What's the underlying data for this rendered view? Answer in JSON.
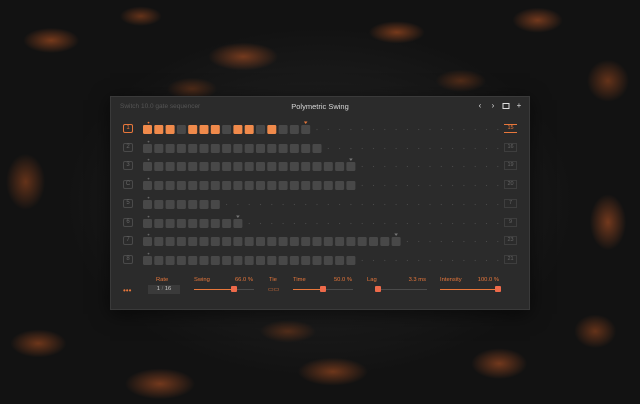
{
  "header": {
    "app_title": "Switch 10.0 gate sequencer",
    "preset_name": "Polymetric Swing"
  },
  "colors": {
    "accent": "#e8773b",
    "step_off": "#484848",
    "step_on": "#f08a4b",
    "panel": "#2b2b2b",
    "knob": "#ee6a4a"
  },
  "tracks": [
    {
      "label": "1",
      "length": "15",
      "steps": 15,
      "active_steps": [
        0,
        1,
        2,
        4,
        5,
        6,
        8,
        9,
        11
      ],
      "playhead": 14,
      "selected": true
    },
    {
      "label": "2",
      "length": "16",
      "steps": 16,
      "active_steps": [],
      "playhead": null,
      "selected": false
    },
    {
      "label": "3",
      "length": "19",
      "steps": 19,
      "active_steps": [],
      "playhead": 18,
      "selected": false
    },
    {
      "label": "C",
      "length": "20",
      "steps": 19,
      "active_steps": [],
      "playhead": null,
      "selected": false
    },
    {
      "label": "5",
      "length": "7",
      "steps": 7,
      "active_steps": [],
      "playhead": null,
      "selected": false
    },
    {
      "label": "6",
      "length": "9",
      "steps": 9,
      "active_steps": [],
      "playhead": 8,
      "selected": false
    },
    {
      "label": "7",
      "length": "23",
      "steps": 23,
      "active_steps": [],
      "playhead": 22,
      "selected": false
    },
    {
      "label": "8",
      "length": "21",
      "steps": 19,
      "active_steps": [],
      "playhead": null,
      "selected": false
    }
  ],
  "controls": {
    "rate": {
      "label": "Rate",
      "numerator": "1",
      "separator": "/",
      "denominator": "16"
    },
    "swing": {
      "label": "Swing",
      "value": "66.0 %",
      "level": 0.66
    },
    "tie": {
      "label": "Tie"
    },
    "time": {
      "label": "Time",
      "value": "50.0 %",
      "level": 0.5
    },
    "lag": {
      "label": "Lag",
      "value": "3.3 ms",
      "level": 0.05
    },
    "intensity": {
      "label": "Intensity",
      "value": "100.0 %",
      "level": 1.0
    }
  }
}
